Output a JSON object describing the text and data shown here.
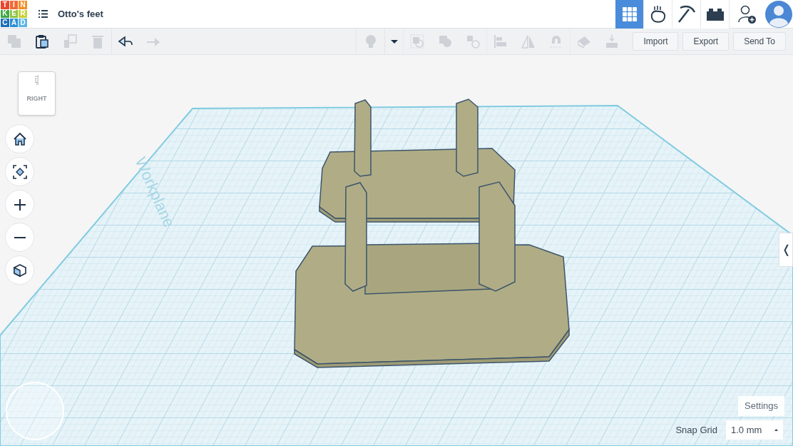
{
  "header": {
    "logo_letters": [
      "T",
      "I",
      "N",
      "K",
      "E",
      "R",
      "C",
      "A",
      "D"
    ],
    "design_title": "Otto's feet"
  },
  "view_modes": [
    {
      "kind": "grid",
      "selected": true
    },
    {
      "kind": "sim",
      "selected": false
    },
    {
      "kind": "pickaxe",
      "selected": false
    },
    {
      "kind": "brick",
      "selected": false
    }
  ],
  "toolbar_left": [
    {
      "kind": "copy",
      "disabled": true
    },
    {
      "kind": "paste",
      "disabled": false
    },
    {
      "kind": "duplicate",
      "disabled": true
    },
    {
      "kind": "delete",
      "disabled": true
    },
    {
      "kind": "undo",
      "disabled": false
    },
    {
      "kind": "redo",
      "disabled": true
    }
  ],
  "toolbar_right": [
    {
      "kind": "light",
      "disabled": true
    },
    {
      "kind": "dropdown",
      "disabled": false
    },
    {
      "kind": "group",
      "disabled": true
    },
    {
      "kind": "ungroup",
      "disabled": true
    },
    {
      "kind": "hole",
      "disabled": true
    },
    {
      "kind": "align",
      "disabled": true
    },
    {
      "kind": "mirror",
      "disabled": true
    },
    {
      "kind": "magnet",
      "disabled": true
    },
    {
      "kind": "cruise",
      "disabled": true
    },
    {
      "kind": "drop",
      "disabled": true
    }
  ],
  "action_buttons": [
    "Import",
    "Export",
    "Send To"
  ],
  "view_cube": {
    "top": "TOP",
    "front": "RIGHT"
  },
  "workplane_label": "Workplane",
  "settings_button": "Settings",
  "snap_grid": {
    "label": "Snap Grid",
    "value": "1.0 mm"
  },
  "side_panel_toggle": "❬"
}
